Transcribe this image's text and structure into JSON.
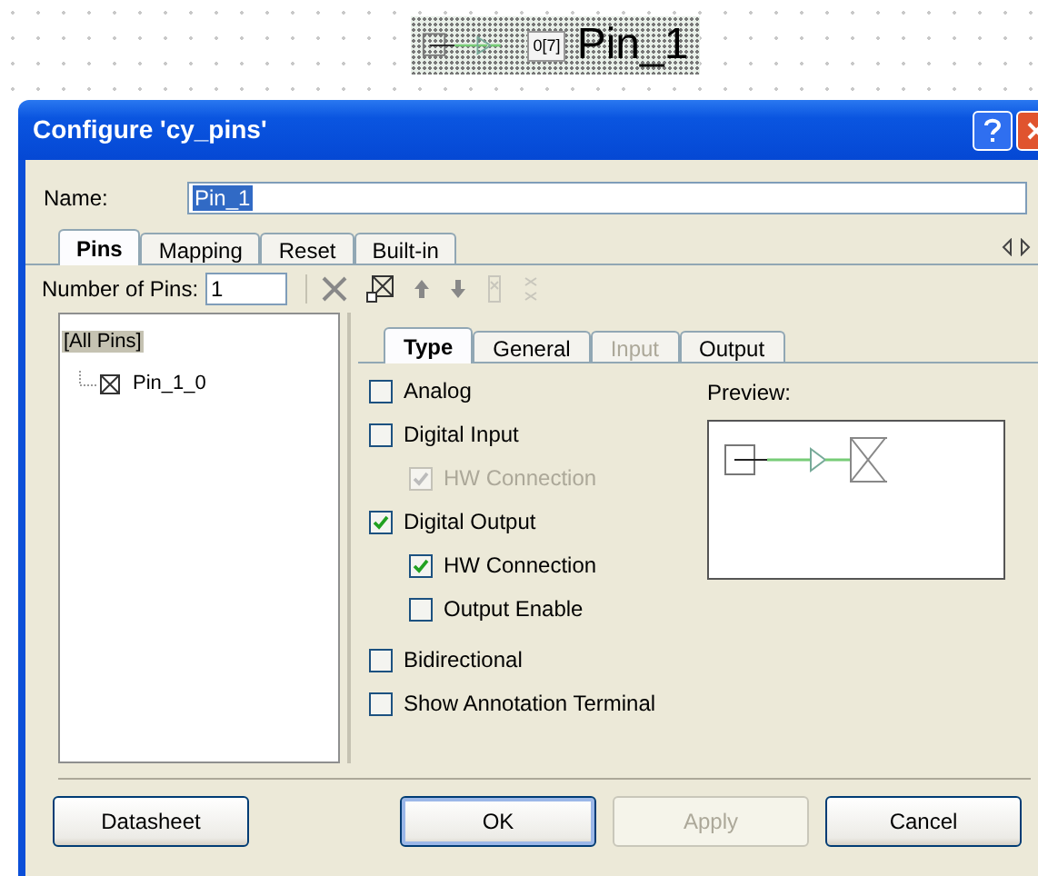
{
  "canvas": {
    "component": {
      "index_label": "0[7]",
      "name": "Pin_1"
    }
  },
  "window": {
    "title": "Configure 'cy_pins'"
  },
  "name_field": {
    "label": "Name:",
    "value": "Pin_1"
  },
  "tabs": [
    {
      "label": "Pins",
      "selected": true
    },
    {
      "label": "Mapping",
      "selected": false
    },
    {
      "label": "Reset",
      "selected": false
    },
    {
      "label": "Built-in",
      "selected": false
    }
  ],
  "pin_count": {
    "label": "Number of Pins:",
    "value": "1"
  },
  "toolbar": [
    {
      "kind": "delete",
      "disabled": false
    },
    {
      "kind": "pin",
      "disabled": false
    },
    {
      "kind": "up",
      "disabled": false
    },
    {
      "kind": "down",
      "disabled": false
    },
    {
      "kind": "group",
      "disabled": true
    },
    {
      "kind": "ungroup",
      "disabled": true
    }
  ],
  "tree": {
    "label": "[All Pins]",
    "selected": true,
    "children": [
      {
        "label": "Pin_1_0",
        "selected": false
      }
    ]
  },
  "inner_tabs": [
    {
      "label": "Type",
      "selected": true,
      "disabled": false
    },
    {
      "label": "General",
      "selected": false,
      "disabled": false
    },
    {
      "label": "Input",
      "selected": false,
      "disabled": true
    },
    {
      "label": "Output",
      "selected": false,
      "disabled": false
    }
  ],
  "options": [
    {
      "label": "Analog",
      "checked": false,
      "disabled": false
    },
    {
      "label": "Digital Input",
      "checked": false,
      "disabled": false,
      "children": [
        {
          "label": "HW Connection",
          "checked": true,
          "disabled": true
        }
      ]
    },
    {
      "label": "Digital Output",
      "checked": true,
      "disabled": false,
      "children": [
        {
          "label": "HW Connection",
          "checked": true,
          "disabled": false
        },
        {
          "label": "Output Enable",
          "checked": false,
          "disabled": false
        }
      ]
    },
    {
      "label": "Bidirectional",
      "checked": false,
      "disabled": false
    },
    {
      "label": "Show Annotation Terminal",
      "checked": false,
      "disabled": false
    }
  ],
  "preview": {
    "label": "Preview:"
  },
  "buttons": [
    {
      "label": "Datasheet",
      "disabled": false,
      "default": false
    },
    {
      "label": "OK",
      "disabled": false,
      "default": true
    },
    {
      "label": "Apply",
      "disabled": true,
      "default": false
    },
    {
      "label": "Cancel",
      "disabled": false,
      "default": false
    }
  ]
}
